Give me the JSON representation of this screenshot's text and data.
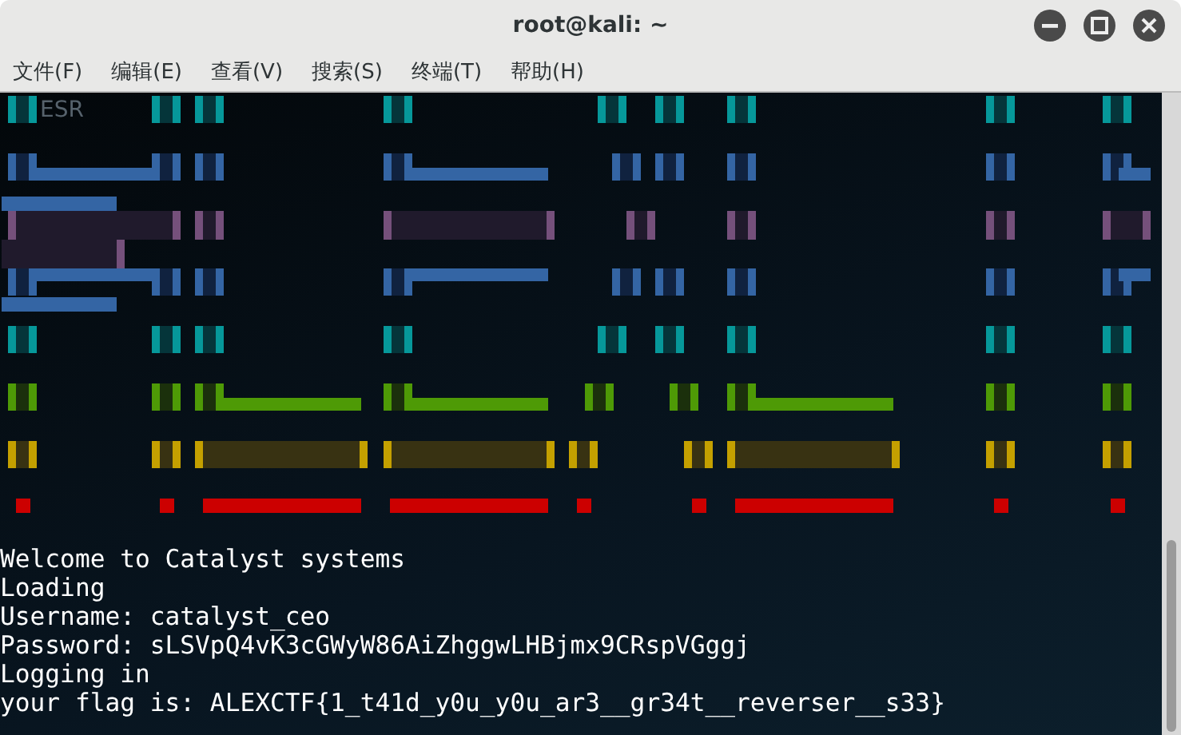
{
  "window": {
    "title": "root@kali: ~"
  },
  "menu": [
    {
      "label": "文件(F)"
    },
    {
      "label": "编辑(E)"
    },
    {
      "label": "查看(V)"
    },
    {
      "label": "搜索(S)"
    },
    {
      "label": "终端(T)"
    },
    {
      "label": "帮助(H)"
    }
  ],
  "terminal": {
    "background_label": "ESR",
    "lines": [
      "Welcome to Catalyst systems",
      "Loading",
      "Username: catalyst_ceo",
      "Password: sLSVpQ4vK3cGWyW86AiZhggwLHBjmx9CRspVGggj",
      "Logging in",
      "your flag is: ALEXCTF{1_t41d_y0u_y0u_ar3__gr34t__reverser__s33}"
    ]
  }
}
